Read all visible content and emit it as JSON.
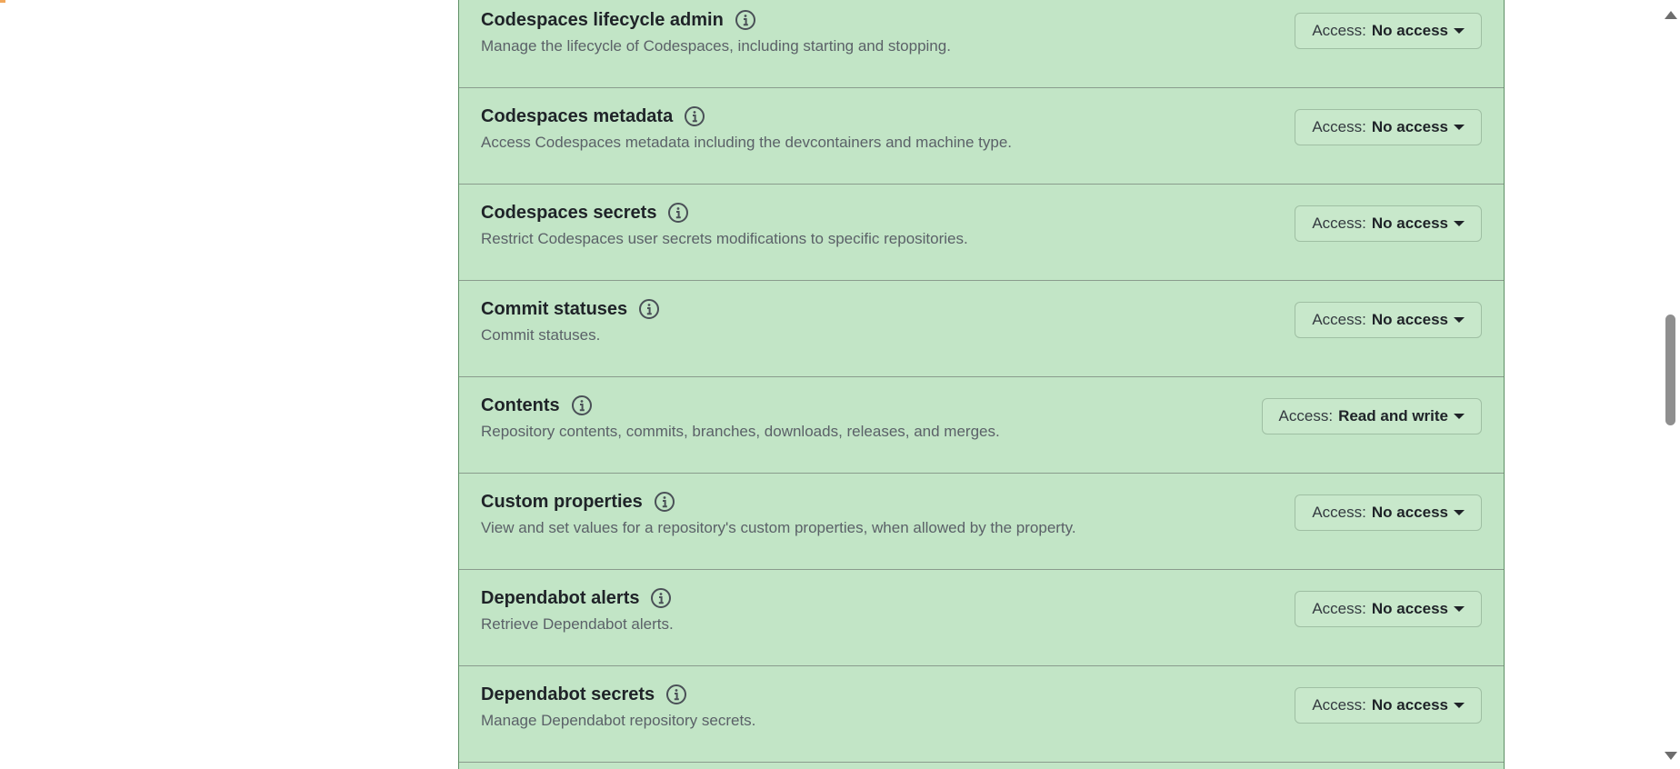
{
  "access_prefix": "Access:",
  "permissions": [
    {
      "title": "Codespaces lifecycle admin",
      "description": "Manage the lifecycle of Codespaces, including starting and stopping.",
      "access": "No access"
    },
    {
      "title": "Codespaces metadata",
      "description": "Access Codespaces metadata including the devcontainers and machine type.",
      "access": "No access"
    },
    {
      "title": "Codespaces secrets",
      "description": "Restrict Codespaces user secrets modifications to specific repositories.",
      "access": "No access"
    },
    {
      "title": "Commit statuses",
      "description": "Commit statuses.",
      "access": "No access"
    },
    {
      "title": "Contents",
      "description": "Repository contents, commits, branches, downloads, releases, and merges.",
      "access": "Read and write"
    },
    {
      "title": "Custom properties",
      "description": "View and set values for a repository's custom properties, when allowed by the property.",
      "access": "No access"
    },
    {
      "title": "Dependabot alerts",
      "description": "Retrieve Dependabot alerts.",
      "access": "No access"
    },
    {
      "title": "Dependabot secrets",
      "description": "Manage Dependabot repository secrets.",
      "access": "No access"
    }
  ],
  "icons": {
    "info": "info-icon",
    "dropdown": "caret-down-icon",
    "scroll_up": "arrow-up-icon",
    "scroll_down": "arrow-down-icon"
  },
  "colors": {
    "panel_background": "#c2e5c6",
    "row_divider": "#8a9c8d",
    "button_background": "#c8e8cb"
  }
}
